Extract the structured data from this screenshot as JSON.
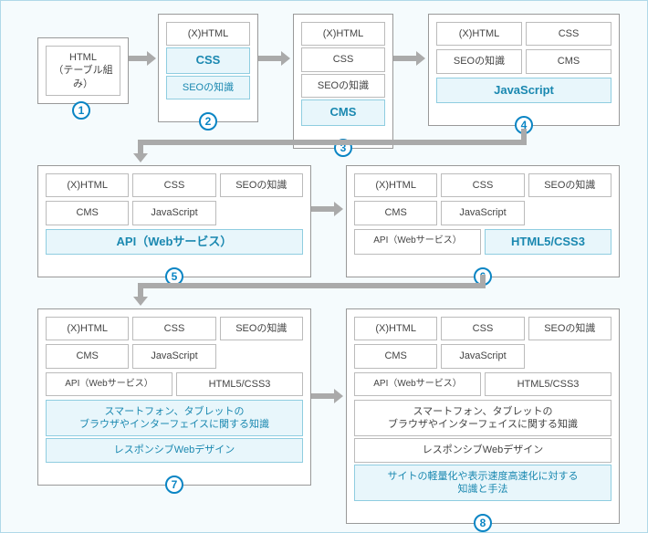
{
  "cards": {
    "c1": {
      "num": "1",
      "rows": [
        [
          "HTML\n（テーブル組み）"
        ]
      ]
    },
    "c2": {
      "num": "2",
      "rows": [
        [
          "(X)HTML"
        ],
        [
          "CSS"
        ],
        [
          "SEOの知識"
        ]
      ],
      "hl": [
        false,
        true,
        true
      ]
    },
    "c3": {
      "num": "3",
      "rows": [
        [
          "(X)HTML"
        ],
        [
          "CSS"
        ],
        [
          "SEOの知識"
        ],
        [
          "CMS"
        ]
      ],
      "hl": [
        false,
        false,
        false,
        true
      ]
    },
    "c4": {
      "num": "4",
      "rows": [
        [
          "(X)HTML",
          "CSS"
        ],
        [
          "SEOの知識",
          "CMS"
        ],
        [
          "JavaScript"
        ]
      ],
      "hl": [
        [
          false,
          false
        ],
        [
          false,
          false
        ],
        [
          true
        ]
      ]
    },
    "c5": {
      "num": "5",
      "rows": [
        [
          "(X)HTML",
          "CSS",
          "SEOの知識"
        ],
        [
          "CMS",
          "JavaScript",
          ""
        ],
        [
          "API（Webサービス）"
        ]
      ],
      "hl": [
        [
          false,
          false,
          false
        ],
        [
          false,
          false,
          false
        ],
        [
          true
        ]
      ]
    },
    "c6": {
      "num": "6",
      "rows": [
        [
          "(X)HTML",
          "CSS",
          "SEOの知識"
        ],
        [
          "CMS",
          "JavaScript",
          ""
        ],
        [
          "API（Webサービス）",
          "HTML5/CSS3"
        ]
      ],
      "hl": [
        [
          false,
          false,
          false
        ],
        [
          false,
          false,
          false
        ],
        [
          false,
          true
        ]
      ]
    },
    "c7": {
      "num": "7",
      "rows": [
        [
          "(X)HTML",
          "CSS",
          "SEOの知識"
        ],
        [
          "CMS",
          "JavaScript",
          ""
        ],
        [
          "API（Webサービス）",
          "HTML5/CSS3"
        ],
        [
          "スマートフォン、タブレットの\nブラウザやインターフェイスに関する知識"
        ],
        [
          "レスポンシブWebデザイン"
        ]
      ],
      "hl": [
        [
          false,
          false,
          false
        ],
        [
          false,
          false,
          false
        ],
        [
          false,
          false
        ],
        [
          true
        ],
        [
          true
        ]
      ]
    },
    "c8": {
      "num": "8",
      "rows": [
        [
          "(X)HTML",
          "CSS",
          "SEOの知識"
        ],
        [
          "CMS",
          "JavaScript",
          ""
        ],
        [
          "API（Webサービス）",
          "HTML5/CSS3"
        ],
        [
          "スマートフォン、タブレットの\nブラウザやインターフェイスに関する知識"
        ],
        [
          "レスポンシブWebデザイン"
        ],
        [
          "サイトの軽量化や表示速度高速化に対する\n知識と手法"
        ]
      ],
      "hl": [
        [
          false,
          false,
          false
        ],
        [
          false,
          false,
          false
        ],
        [
          false,
          false
        ],
        [
          false
        ],
        [
          false
        ],
        [
          true
        ]
      ]
    }
  }
}
